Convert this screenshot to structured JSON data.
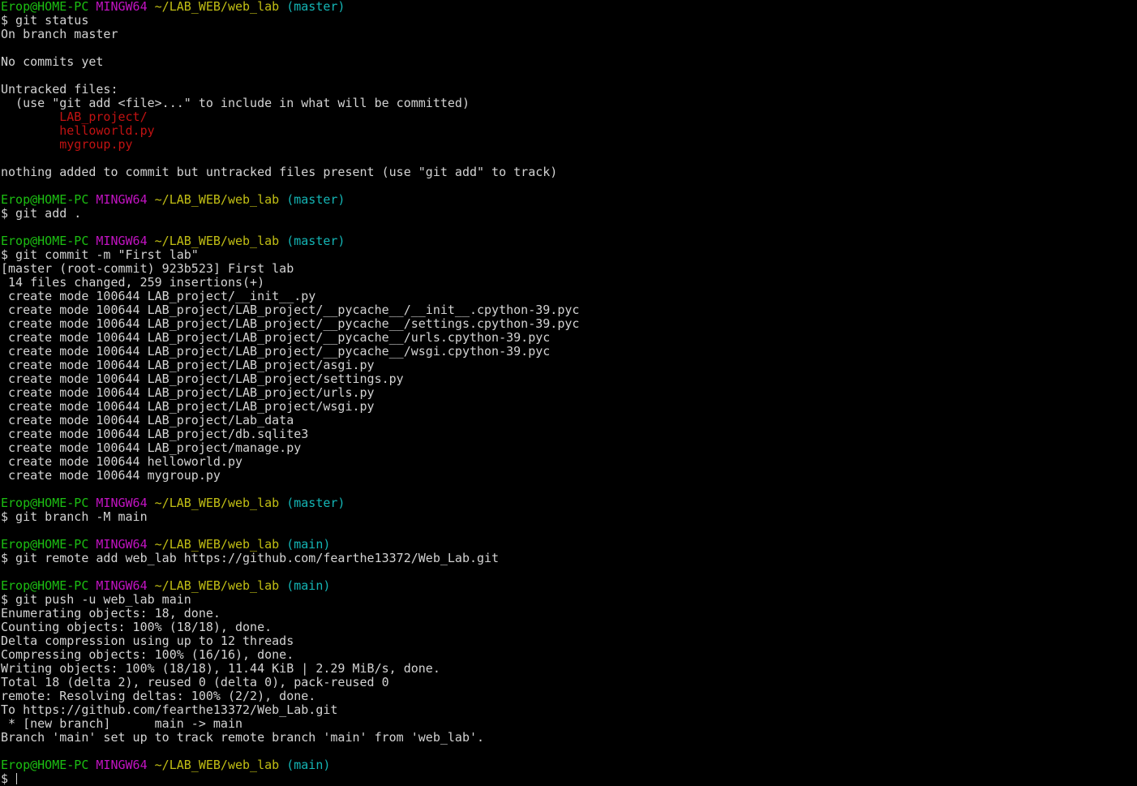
{
  "colors": {
    "background": "#000000",
    "text": "#d3d3d3",
    "user_host": "#1cbf12",
    "msystem": "#c113c1",
    "path": "#c2bf14",
    "branch": "#14b5b5",
    "untracked": "#c11212"
  },
  "lines": [
    {
      "type": "prompt",
      "user": "Erop@HOME-PC",
      "sys": "MINGW64",
      "path": "~/LAB_WEB/web_lab",
      "branch": "(master)"
    },
    {
      "type": "text",
      "text": "$ git status"
    },
    {
      "type": "text",
      "text": "On branch master"
    },
    {
      "type": "text",
      "text": ""
    },
    {
      "type": "text",
      "text": "No commits yet"
    },
    {
      "type": "text",
      "text": ""
    },
    {
      "type": "text",
      "text": "Untracked files:"
    },
    {
      "type": "text",
      "text": "  (use \"git add <file>...\" to include in what will be committed)"
    },
    {
      "type": "untracked",
      "text": "        LAB_project/"
    },
    {
      "type": "untracked",
      "text": "        helloworld.py"
    },
    {
      "type": "untracked",
      "text": "        mygroup.py"
    },
    {
      "type": "text",
      "text": ""
    },
    {
      "type": "text",
      "text": "nothing added to commit but untracked files present (use \"git add\" to track)"
    },
    {
      "type": "text",
      "text": ""
    },
    {
      "type": "prompt",
      "user": "Erop@HOME-PC",
      "sys": "MINGW64",
      "path": "~/LAB_WEB/web_lab",
      "branch": "(master)"
    },
    {
      "type": "text",
      "text": "$ git add ."
    },
    {
      "type": "text",
      "text": ""
    },
    {
      "type": "prompt",
      "user": "Erop@HOME-PC",
      "sys": "MINGW64",
      "path": "~/LAB_WEB/web_lab",
      "branch": "(master)"
    },
    {
      "type": "text",
      "text": "$ git commit -m \"First lab\""
    },
    {
      "type": "text",
      "text": "[master (root-commit) 923b523] First lab"
    },
    {
      "type": "text",
      "text": " 14 files changed, 259 insertions(+)"
    },
    {
      "type": "text",
      "text": " create mode 100644 LAB_project/__init__.py"
    },
    {
      "type": "text",
      "text": " create mode 100644 LAB_project/LAB_project/__pycache__/__init__.cpython-39.pyc"
    },
    {
      "type": "text",
      "text": " create mode 100644 LAB_project/LAB_project/__pycache__/settings.cpython-39.pyc"
    },
    {
      "type": "text",
      "text": " create mode 100644 LAB_project/LAB_project/__pycache__/urls.cpython-39.pyc"
    },
    {
      "type": "text",
      "text": " create mode 100644 LAB_project/LAB_project/__pycache__/wsgi.cpython-39.pyc"
    },
    {
      "type": "text",
      "text": " create mode 100644 LAB_project/LAB_project/asgi.py"
    },
    {
      "type": "text",
      "text": " create mode 100644 LAB_project/LAB_project/settings.py"
    },
    {
      "type": "text",
      "text": " create mode 100644 LAB_project/LAB_project/urls.py"
    },
    {
      "type": "text",
      "text": " create mode 100644 LAB_project/LAB_project/wsgi.py"
    },
    {
      "type": "text",
      "text": " create mode 100644 LAB_project/Lab_data"
    },
    {
      "type": "text",
      "text": " create mode 100644 LAB_project/db.sqlite3"
    },
    {
      "type": "text",
      "text": " create mode 100644 LAB_project/manage.py"
    },
    {
      "type": "text",
      "text": " create mode 100644 helloworld.py"
    },
    {
      "type": "text",
      "text": " create mode 100644 mygroup.py"
    },
    {
      "type": "text",
      "text": ""
    },
    {
      "type": "prompt",
      "user": "Erop@HOME-PC",
      "sys": "MINGW64",
      "path": "~/LAB_WEB/web_lab",
      "branch": "(master)"
    },
    {
      "type": "text",
      "text": "$ git branch -M main"
    },
    {
      "type": "text",
      "text": ""
    },
    {
      "type": "prompt",
      "user": "Erop@HOME-PC",
      "sys": "MINGW64",
      "path": "~/LAB_WEB/web_lab",
      "branch": "(main)"
    },
    {
      "type": "text",
      "text": "$ git remote add web_lab https://github.com/fearthe13372/Web_Lab.git"
    },
    {
      "type": "text",
      "text": ""
    },
    {
      "type": "prompt",
      "user": "Erop@HOME-PC",
      "sys": "MINGW64",
      "path": "~/LAB_WEB/web_lab",
      "branch": "(main)"
    },
    {
      "type": "text",
      "text": "$ git push -u web_lab main"
    },
    {
      "type": "text",
      "text": "Enumerating objects: 18, done."
    },
    {
      "type": "text",
      "text": "Counting objects: 100% (18/18), done."
    },
    {
      "type": "text",
      "text": "Delta compression using up to 12 threads"
    },
    {
      "type": "text",
      "text": "Compressing objects: 100% (16/16), done."
    },
    {
      "type": "text",
      "text": "Writing objects: 100% (18/18), 11.44 KiB | 2.29 MiB/s, done."
    },
    {
      "type": "text",
      "text": "Total 18 (delta 2), reused 0 (delta 0), pack-reused 0"
    },
    {
      "type": "text",
      "text": "remote: Resolving deltas: 100% (2/2), done."
    },
    {
      "type": "text",
      "text": "To https://github.com/fearthe13372/Web_Lab.git"
    },
    {
      "type": "text",
      "text": " * [new branch]      main -> main"
    },
    {
      "type": "text",
      "text": "Branch 'main' set up to track remote branch 'main' from 'web_lab'."
    },
    {
      "type": "text",
      "text": ""
    },
    {
      "type": "prompt",
      "user": "Erop@HOME-PC",
      "sys": "MINGW64",
      "path": "~/LAB_WEB/web_lab",
      "branch": "(main)"
    },
    {
      "type": "input",
      "text": "$ "
    }
  ]
}
